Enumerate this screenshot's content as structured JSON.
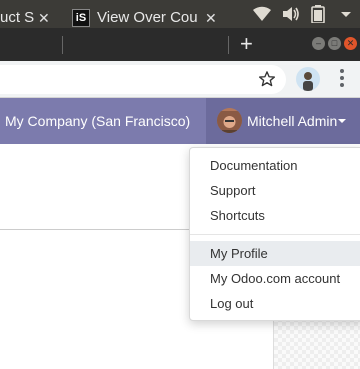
{
  "browser": {
    "tabs": [
      {
        "title": "uct S",
        "close": "✕"
      },
      {
        "favicon": "iS",
        "title": "View Over Cou",
        "close": "✕"
      }
    ],
    "new_tab": "+"
  },
  "navbar": {
    "company": "My Company (San Francisco)",
    "user": "Mitchell Admin",
    "color": "#7c7bad"
  },
  "user_menu": {
    "items": [
      {
        "label": "Documentation"
      },
      {
        "label": "Support"
      },
      {
        "label": "Shortcuts"
      },
      {
        "label": "My Profile"
      },
      {
        "label": "My Odoo.com account"
      },
      {
        "label": "Log out"
      }
    ]
  }
}
